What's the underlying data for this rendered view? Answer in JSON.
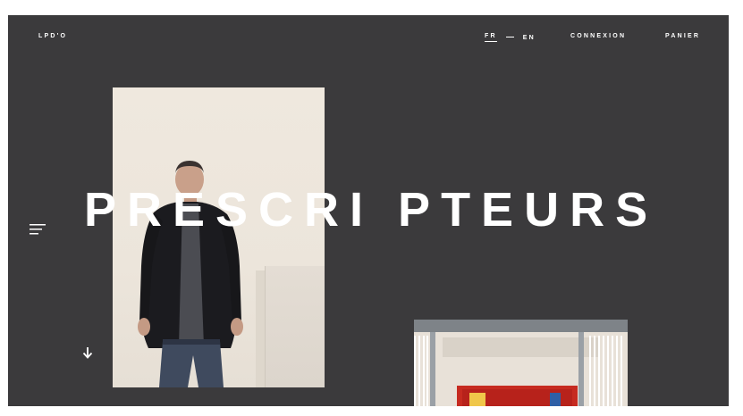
{
  "header": {
    "logo": "LPD'O",
    "lang_active": "FR",
    "lang_other": "EN",
    "login": "CONNEXION",
    "cart": "PANIER"
  },
  "hero": {
    "title": "PRESCRI PTEURS"
  },
  "icons": {
    "menu": "menu-icon",
    "scroll": "arrow-down-icon"
  },
  "colors": {
    "background": "#3b3a3c",
    "text": "#ffffff"
  }
}
